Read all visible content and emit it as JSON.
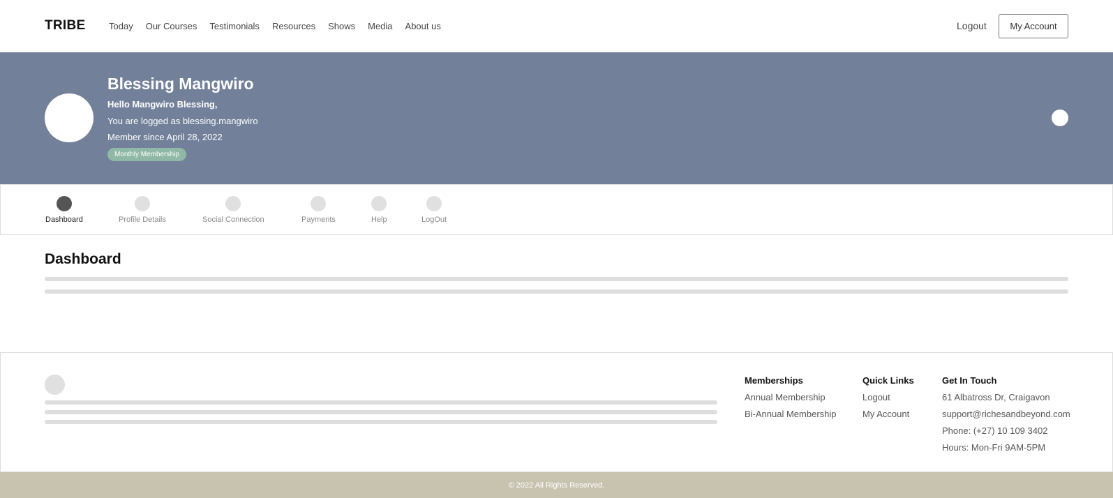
{
  "header": {
    "logo": "TRIBE",
    "nav": [
      "Today",
      "Our Courses",
      "Testimonials",
      "Resources",
      "Shows",
      "Media",
      "About us"
    ],
    "logout": "Logout",
    "my_account": "My Account"
  },
  "hero": {
    "name": "Blessing Mangwiro",
    "hello": "Hello Mangwiro Blessing,",
    "logged_as": "You are logged as blessing.mangwiro",
    "member_since": "Member since April 28, 2022",
    "badge": "Monthly Membership",
    "background_color": "#72809a",
    "badge_color": "#8fb8a6"
  },
  "tabs": [
    {
      "label": "Dashboard",
      "active": true
    },
    {
      "label": "Profile Details",
      "active": false
    },
    {
      "label": "Social Connection",
      "active": false
    },
    {
      "label": "Payments",
      "active": false
    },
    {
      "label": "Help",
      "active": false
    },
    {
      "label": "LogOut",
      "active": false
    }
  ],
  "dashboard": {
    "title": "Dashboard"
  },
  "footer": {
    "memberships": {
      "heading": "Memberships",
      "items": [
        "Annual Membership",
        "Bi-Annual Membership"
      ]
    },
    "quick_links": {
      "heading": "Quick Links",
      "items": [
        "Logout",
        "My Account"
      ]
    },
    "contact": {
      "heading": "Get In Touch",
      "address": "61 Albatross Dr, Craigavon",
      "email": "support@richesandbeyond.com",
      "phone": "Phone: (+27) 10 109 3402",
      "hours": "Hours: Mon-Fri 9AM-5PM"
    },
    "copyright": "© 2022 All Rights Reserved.",
    "copyright_bg": "#c8c3ae"
  }
}
